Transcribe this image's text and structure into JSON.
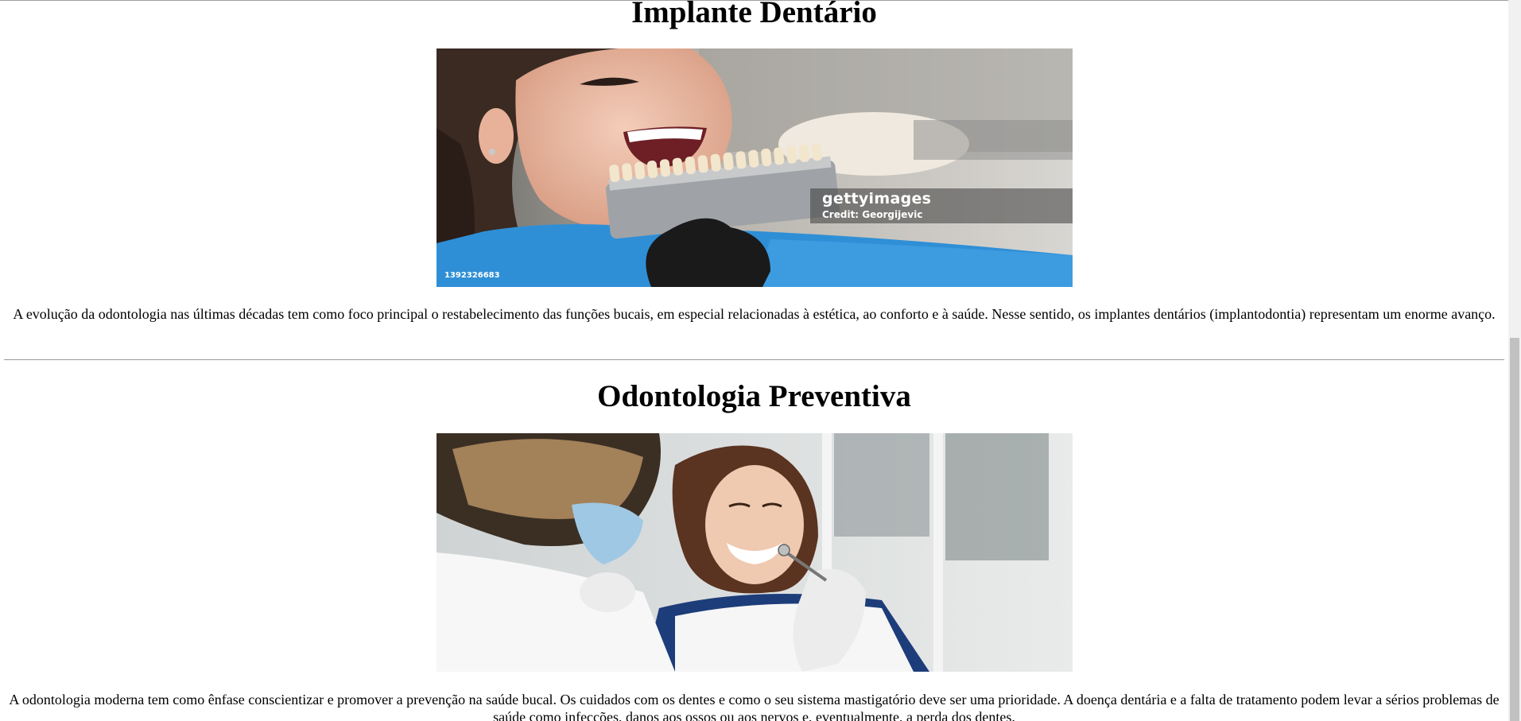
{
  "sections": [
    {
      "title": "Implante Dentário",
      "image": {
        "watermark_brand": "gettyimages",
        "watermark_credit": "Credit: Georgijevic",
        "stock_id": "1392326683",
        "alt": "Paciente sorrindo com escala de cores de dentes"
      },
      "body": "A evolução da odontologia nas últimas décadas tem como foco principal o restabelecimento das funções bucais, em especial relacionadas à estética, ao conforto e à saúde. Nesse sentido, os implantes dentários (implantodontia) representam um enorme avanço."
    },
    {
      "title": "Odontologia Preventiva",
      "image": {
        "alt": "Dentista examinando paciente sorridente"
      },
      "body": "A odontologia moderna tem como ênfase conscientizar e promover a prevenção na saúde bucal. Os cuidados com os dentes e como o seu sistema mastigatório deve ser uma prioridade. A doença dentária e a falta de tratamento podem levar a sérios problemas de saúde como infecções, danos aos ossos ou aos nervos e, eventualmente, a perda dos dentes."
    }
  ],
  "colors": {
    "scrub_blue": "#2f8fd6",
    "glove_black": "#1a1a1a",
    "background": "#ffffff"
  }
}
